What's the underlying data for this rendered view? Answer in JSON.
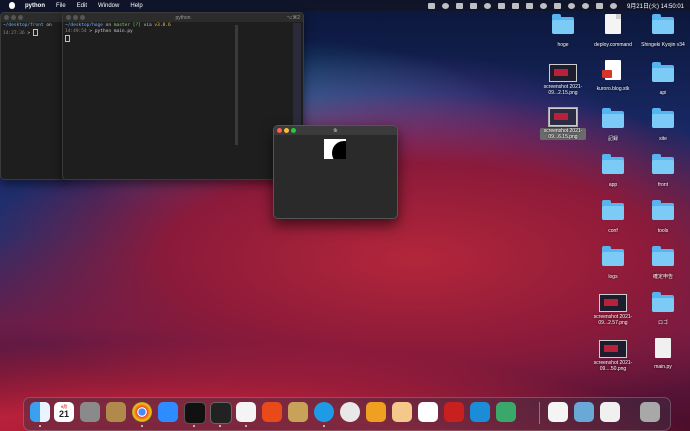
{
  "menubar": {
    "app_name": "python",
    "items": [
      "File",
      "Edit",
      "Window",
      "Help"
    ],
    "clock": "9月21日(火)  14:50:01"
  },
  "term1": {
    "title": "",
    "line_pwd": "~/desktop/front",
    "line_on": " on ",
    "line_time": "14:27:36",
    "line_prompt": " > "
  },
  "term2": {
    "title": "python",
    "shortcut": "⌥⌘2",
    "line_pwd": "~/desktop/hoge",
    "line_on": " on ",
    "line_branch": "master [?]",
    "line_via": " via ",
    "line_ver": "v3.8.6",
    "line_time": "14:49:54",
    "line_cmd": " > python main.py"
  },
  "tk_window": {
    "title": "tk"
  },
  "desktop_icons": {
    "hoge": "hoge",
    "deploy": "deploy.command",
    "shingeki": "Shingeki Kyojin v34",
    "screenshot1": "screenshot 2021-09...2.15.png",
    "kuroro": "kuroro.blog.stk",
    "api": "api",
    "screenshot2": "screenshot 2021-09...6.15.png",
    "kiroku": "記録",
    "site": "site",
    "app": "app",
    "front": "front",
    "conf": "conf",
    "tools": "tools",
    "logs": "logs",
    "kakutei": "確定申告",
    "screenshot3": "screenshot 2021-09...2.57.png",
    "logo": "ロゴ",
    "screenshot4": "screenshot 2021-09....50.png",
    "mainpy": "main.py"
  },
  "dock": {
    "calendar_month": "9月",
    "calendar_day": "21"
  },
  "colors": {
    "folder": "#56b4f0",
    "traffic_red": "#ff5f57",
    "traffic_yellow": "#febc2e",
    "traffic_green": "#28c840"
  }
}
